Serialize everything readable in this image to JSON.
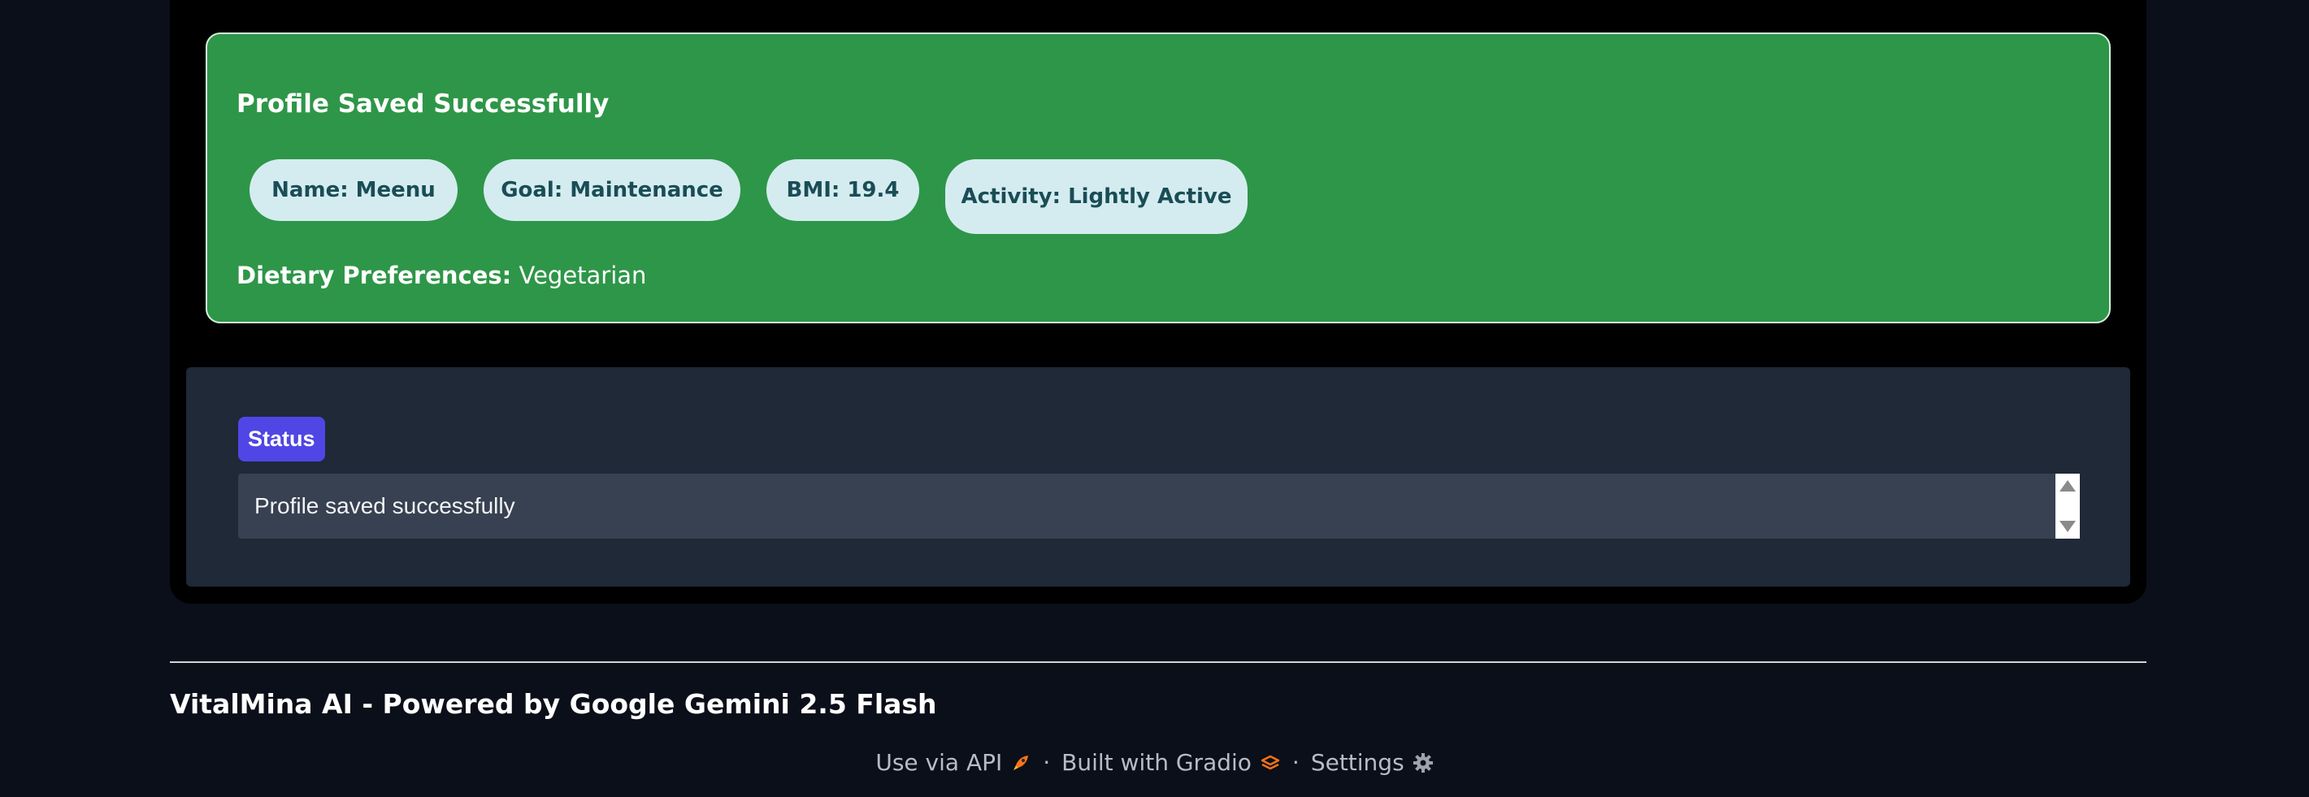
{
  "profile_card": {
    "title": "Profile Saved Successfully",
    "chips": {
      "name": "Name: Meenu",
      "goal": "Goal: Maintenance",
      "bmi": "BMI: 19.4",
      "activity": "Activity: Lightly Active"
    },
    "dietary_label": "Dietary Preferences:",
    "dietary_value": "Vegetarian"
  },
  "status": {
    "label": "Status",
    "value": "Profile saved successfully"
  },
  "footer": {
    "title": "VitalMina AI - Powered by Google Gemini 2.5 Flash",
    "links": {
      "api": "Use via API",
      "gradio": "Built with Gradio",
      "settings": "Settings"
    },
    "separator": "·"
  },
  "colors": {
    "page_bg": "#0b0f19",
    "card_bg": "#2e9648",
    "chip_bg": "#d4ecf0",
    "status_accent": "#4f46e5"
  },
  "icons": [
    "rocket-icon",
    "gradio-logo-icon",
    "gear-icon"
  ]
}
